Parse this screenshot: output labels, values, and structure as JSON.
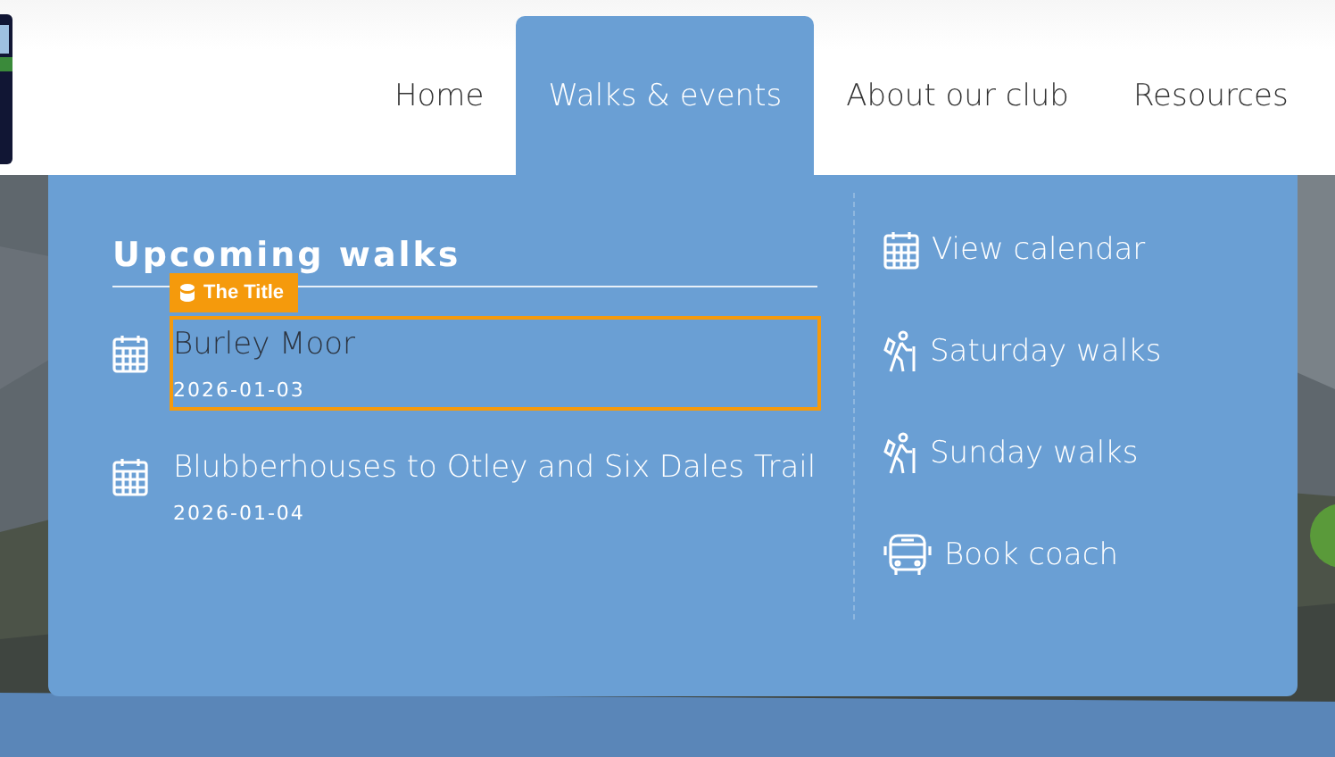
{
  "nav": [
    {
      "label": "Home",
      "selected": false
    },
    {
      "label": "Walks & events",
      "selected": true
    },
    {
      "label": "About our club",
      "selected": false
    },
    {
      "label": "Resources",
      "selected": false
    }
  ],
  "dropdown": {
    "heading": "Upcoming walks",
    "walks": [
      {
        "title": "Burley Moor",
        "date": "2026-01-03",
        "highlighted": true,
        "tag": "The Title"
      },
      {
        "title": "Blubberhouses to Otley and Six Dales Trail",
        "date": "2026-01-04",
        "highlighted": false
      }
    ],
    "links": [
      {
        "label": "View calendar",
        "kind": "calendar"
      },
      {
        "label": "Saturday walks",
        "kind": "hiker"
      },
      {
        "label": "Sunday walks",
        "kind": "hiker"
      },
      {
        "label": "Book coach",
        "kind": "bus"
      }
    ]
  }
}
